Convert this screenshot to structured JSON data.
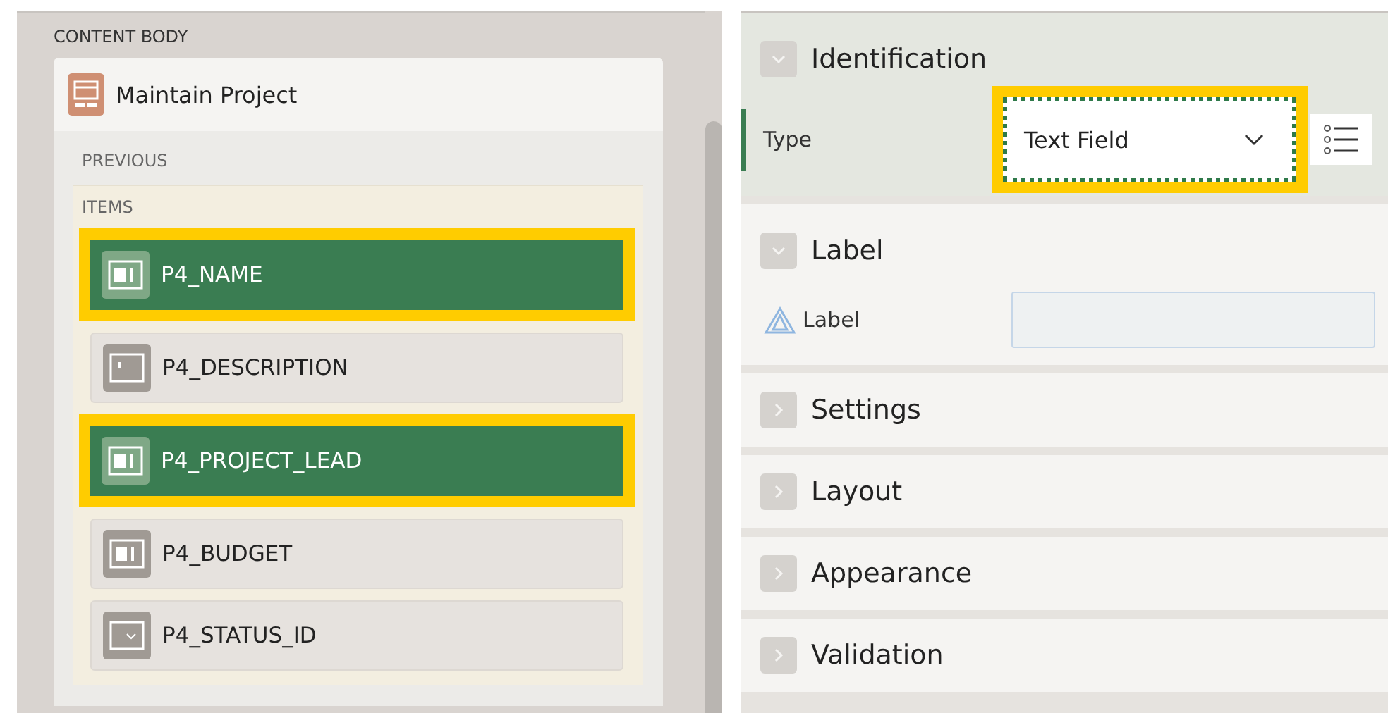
{
  "content_body": {
    "heading": "CONTENT BODY",
    "region": {
      "title": "Maintain Project",
      "position_label": "PREVIOUS",
      "items_label": "ITEMS",
      "items": [
        {
          "name": "P4_NAME",
          "kind": "text",
          "selected": true
        },
        {
          "name": "P4_DESCRIPTION",
          "kind": "textarea",
          "selected": false
        },
        {
          "name": "P4_PROJECT_LEAD",
          "kind": "text",
          "selected": true
        },
        {
          "name": "P4_BUDGET",
          "kind": "number",
          "selected": false
        },
        {
          "name": "P4_STATUS_ID",
          "kind": "select",
          "selected": false
        }
      ]
    }
  },
  "property_editor": {
    "sections": [
      {
        "title": "Identification",
        "expanded": true,
        "active": true,
        "properties": [
          {
            "label": "Type",
            "kind": "select",
            "value": "Text Field",
            "required": false
          }
        ]
      },
      {
        "title": "Label",
        "expanded": true,
        "active": false,
        "properties": [
          {
            "label": "Label",
            "kind": "text",
            "required": true
          }
        ]
      },
      {
        "title": "Settings",
        "expanded": false,
        "active": false
      },
      {
        "title": "Layout",
        "expanded": false,
        "active": false
      },
      {
        "title": "Appearance",
        "expanded": false,
        "active": false
      },
      {
        "title": "Validation",
        "expanded": false,
        "active": false
      }
    ]
  }
}
